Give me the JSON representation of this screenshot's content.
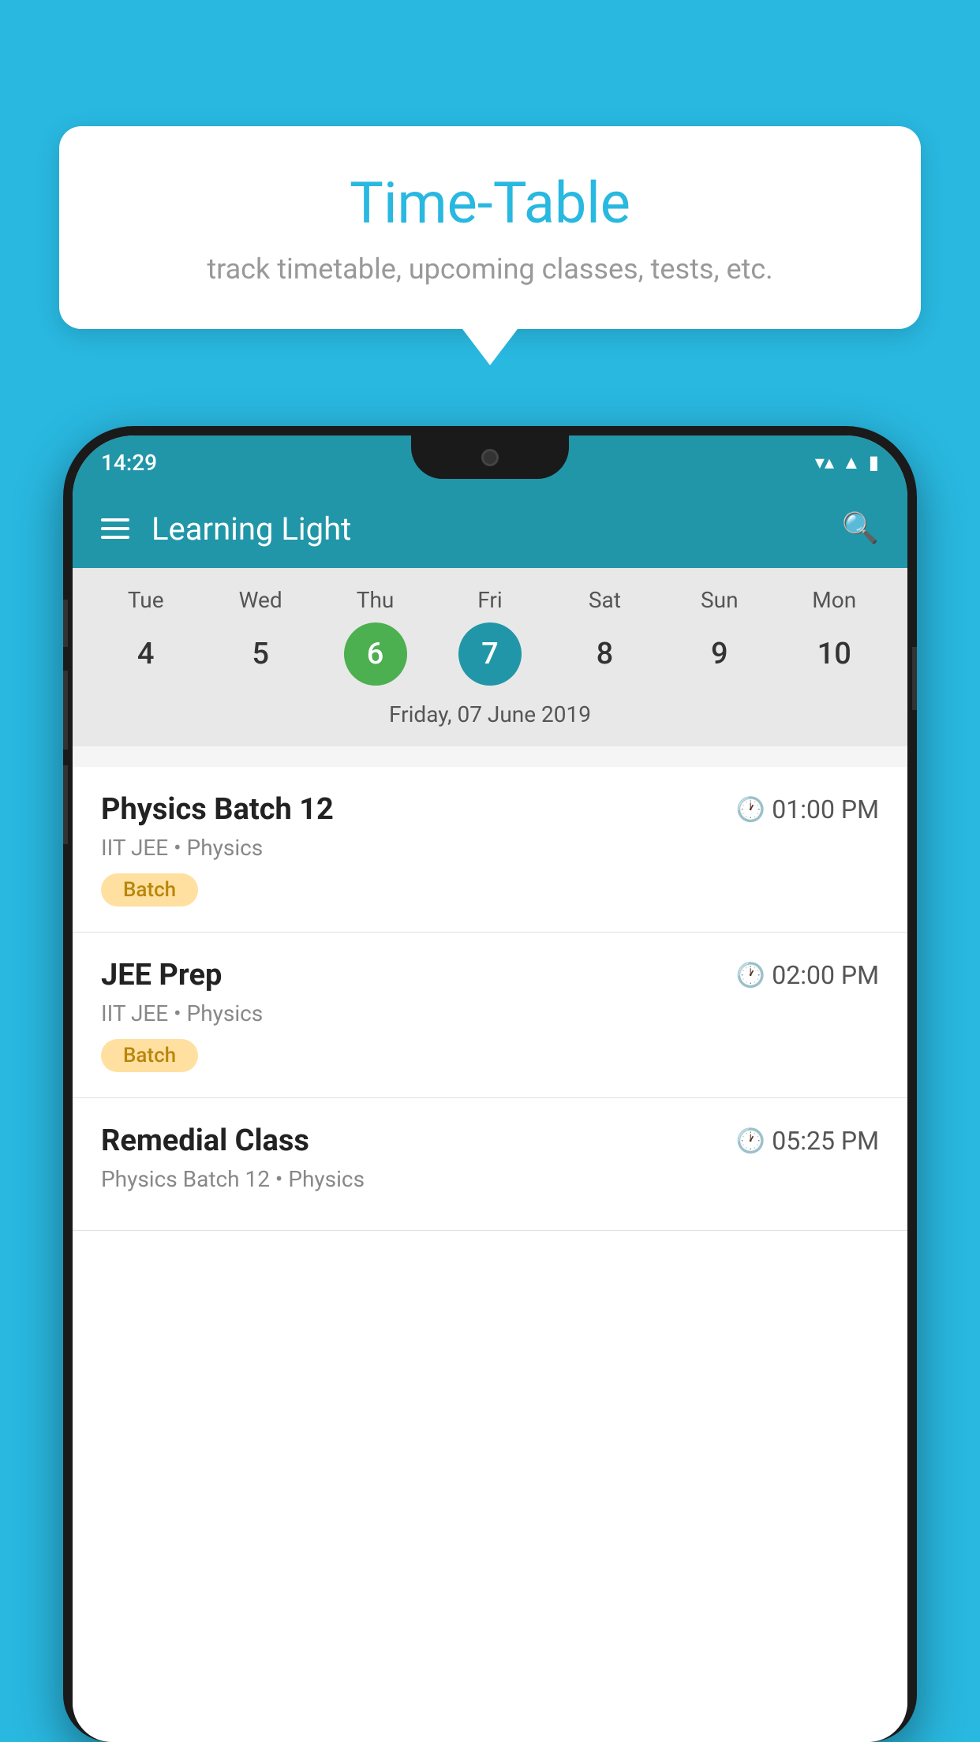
{
  "background_color": "#29b8e0",
  "tooltip": {
    "title": "Time-Table",
    "subtitle": "track timetable, upcoming classes, tests, etc."
  },
  "status_bar": {
    "time": "14:29"
  },
  "app_bar": {
    "title": "Learning Light"
  },
  "calendar": {
    "days": [
      {
        "label": "Tue",
        "num": "4"
      },
      {
        "label": "Wed",
        "num": "5"
      },
      {
        "label": "Thu",
        "num": "6",
        "state": "today"
      },
      {
        "label": "Fri",
        "num": "7",
        "state": "selected"
      },
      {
        "label": "Sat",
        "num": "8"
      },
      {
        "label": "Sun",
        "num": "9"
      },
      {
        "label": "Mon",
        "num": "10"
      }
    ],
    "selected_date_label": "Friday, 07 June 2019"
  },
  "schedule": {
    "items": [
      {
        "name": "Physics Batch 12",
        "time": "01:00 PM",
        "meta": "IIT JEE • Physics",
        "badge": "Batch"
      },
      {
        "name": "JEE Prep",
        "time": "02:00 PM",
        "meta": "IIT JEE • Physics",
        "badge": "Batch"
      },
      {
        "name": "Remedial Class",
        "time": "05:25 PM",
        "meta": "Physics Batch 12 • Physics",
        "badge": ""
      }
    ]
  }
}
